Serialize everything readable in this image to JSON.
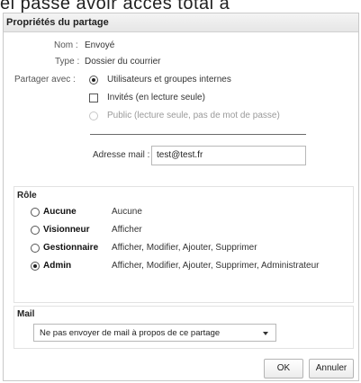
{
  "background_text": "el passe avoir acces total à",
  "dialog": {
    "title": "Propriétés du partage",
    "name_label": "Nom :",
    "name_value": "Envoyé",
    "type_label": "Type :",
    "type_value": "Dossier du courrier",
    "share_with_label": "Partager avec :",
    "share_options": [
      {
        "label": "Utilisateurs et groupes internes",
        "selected": true,
        "enabled": true
      },
      {
        "label": "Invités (en lecture seule)",
        "selected": false,
        "enabled": true,
        "control": "checkbox"
      },
      {
        "label": "Public (lecture seule, pas de mot de passe)",
        "selected": false,
        "enabled": false
      }
    ],
    "email": {
      "label": "Adresse mail :",
      "value": "test@test.fr"
    },
    "role": {
      "title": "Rôle",
      "options": [
        {
          "name": "Aucune",
          "desc": "Aucune",
          "selected": false
        },
        {
          "name": "Visionneur",
          "desc": "Afficher",
          "selected": false
        },
        {
          "name": "Gestionnaire",
          "desc": "Afficher, Modifier, Ajouter, Supprimer",
          "selected": false
        },
        {
          "name": "Admin",
          "desc": "Afficher, Modifier, Ajouter, Supprimer, Administrateur",
          "selected": true
        }
      ]
    },
    "mail": {
      "title": "Mail",
      "select_value": "Ne pas envoyer de mail à propos de ce partage"
    },
    "buttons": {
      "ok": "OK",
      "cancel": "Annuler"
    }
  }
}
